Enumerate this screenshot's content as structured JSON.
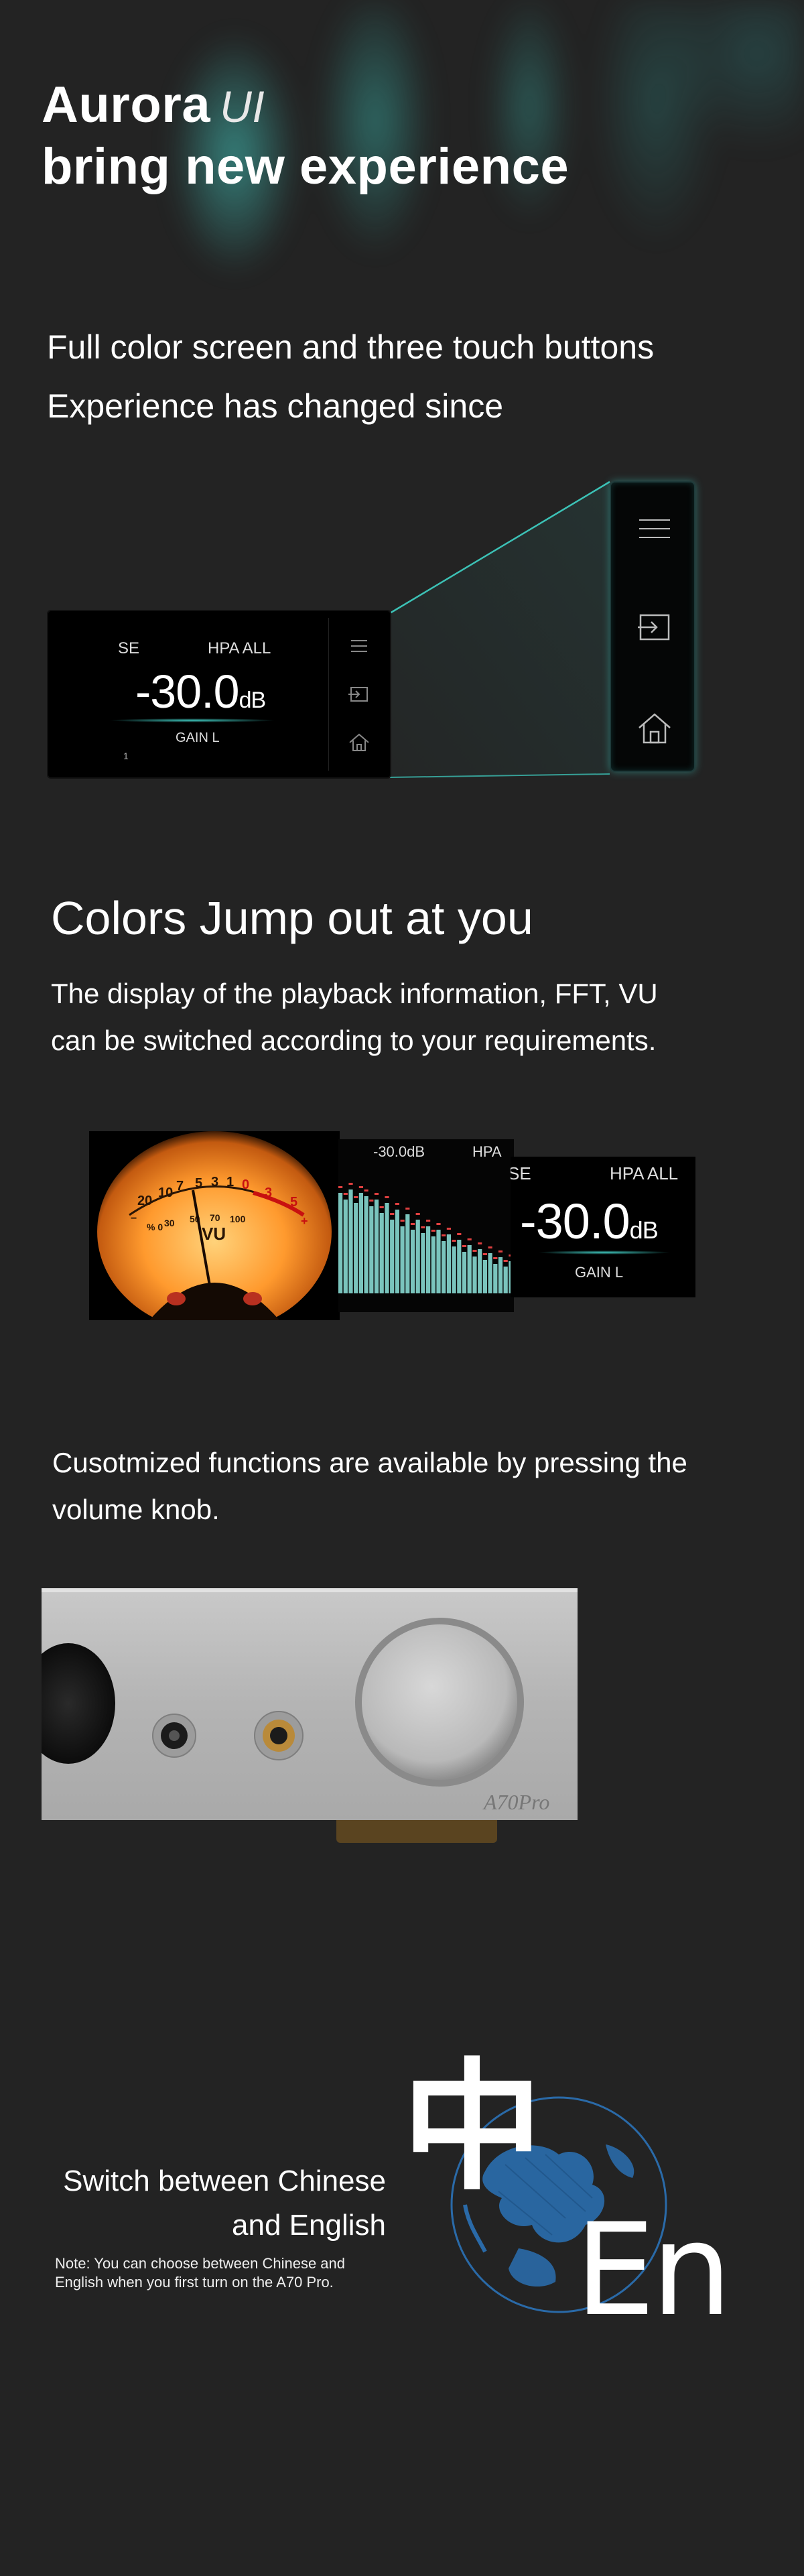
{
  "hero": {
    "title_bold": "Aurora",
    "title_ui": "UI",
    "title_line2": "bring new experience"
  },
  "intro": {
    "line1": "Full color screen and three touch buttons",
    "line2": "Experience has changed since"
  },
  "small_screen": {
    "output": "SE",
    "mode": "HPA ALL",
    "volume": "-30.0",
    "unit": "dB",
    "gain": "GAIN L",
    "index": "1"
  },
  "colors_section": {
    "heading": "Colors Jump out at you",
    "line1": "The display of the playback information, FFT, VU",
    "line2": "can be switched according to your requirements."
  },
  "fft_card": {
    "volume": "-30.0dB",
    "mode": "HPA"
  },
  "volume_card": {
    "output": "SE",
    "mode": "HPA ALL",
    "volume": "-30.0",
    "unit": "dB",
    "gain": "GAIN L"
  },
  "vu_meter": {
    "label": "VU"
  },
  "knob_section": {
    "line1": "Cusotmized functions are available by pressing the",
    "line2": "volume knob."
  },
  "amp": {
    "model": "A70Pro"
  },
  "language": {
    "heading_line1": "Switch between Chinese",
    "heading_line2": "and English",
    "note_line1": "Note: You can choose between Chinese and",
    "note_line2": "English when you first turn on the A70 Pro.",
    "zh_glyph": "中",
    "en_glyph": "En"
  },
  "colors": {
    "background": "#232323",
    "accent": "#3fd3c6",
    "vu_orange": "#ff9a2e",
    "globe_blue": "#2a6aa8"
  }
}
